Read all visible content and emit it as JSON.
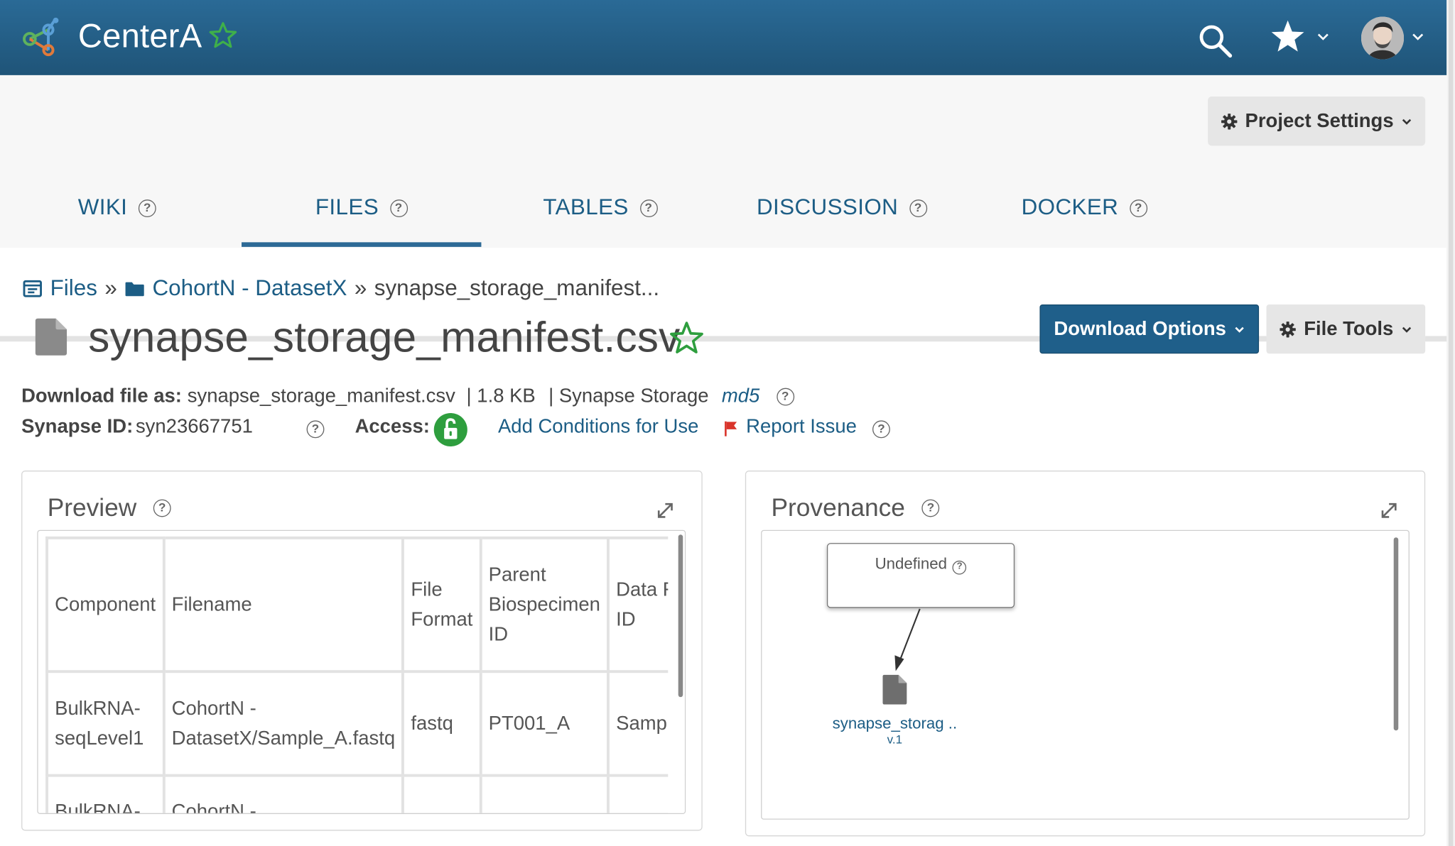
{
  "app": {
    "name": "CenterA"
  },
  "header": {
    "project_settings_label": "Project Settings"
  },
  "tabs": [
    {
      "label": "WIKI",
      "active": false
    },
    {
      "label": "FILES",
      "active": true
    },
    {
      "label": "TABLES",
      "active": false
    },
    {
      "label": "DISCUSSION",
      "active": false
    },
    {
      "label": "DOCKER",
      "active": false
    }
  ],
  "breadcrumb": {
    "root": "Files",
    "folder": "CohortN - DatasetX",
    "current": "synapse_storage_manifest...",
    "separator": "»"
  },
  "file": {
    "name": "synapse_storage_manifest.csv",
    "download_as_label": "Download file as:",
    "download_as_value": "synapse_storage_manifest.csv",
    "size": "| 1.8 KB",
    "storage": "| Synapse Storage",
    "md5_label": "md5",
    "synapse_id_label": "Synapse ID:",
    "synapse_id": "syn23667751",
    "access_label": "Access:",
    "add_conditions": "Add Conditions for Use",
    "report_issue": "Report Issue"
  },
  "buttons": {
    "download_options": "Download Options",
    "file_tools": "File Tools"
  },
  "preview": {
    "title": "Preview",
    "headers": [
      "Component",
      "Filename",
      "File Format",
      "Parent Biospecimen ID",
      "Data F ID"
    ],
    "header_lines": [
      [
        "Component"
      ],
      [
        "Filename"
      ],
      [
        "File",
        "Format"
      ],
      [
        "Parent",
        "Biospecimen",
        "ID"
      ],
      [
        "Data F",
        "ID"
      ]
    ],
    "rows": [
      {
        "component": [
          "BulkRNA-",
          "seqLevel1"
        ],
        "filename": [
          "CohortN -",
          "DatasetX/Sample_A.fastq"
        ],
        "format": "fastq",
        "parent_id": "PT001_A",
        "data_id": "Sampl"
      },
      {
        "component": [
          "BulkRNA-"
        ],
        "filename": [
          "CohortN -"
        ],
        "format": "",
        "parent_id": "",
        "data_id": ""
      }
    ]
  },
  "provenance": {
    "title": "Provenance",
    "activity_label": "Undefined",
    "file_label": "synapse_storag ..",
    "version": "v.1"
  },
  "colors": {
    "topbar": "#1f5478",
    "link": "#1c5d85",
    "primary_button": "#1f5f8a",
    "favorite_star": "#2e9e3e",
    "access_open": "#2e9e3e",
    "flag": "#d9342b"
  }
}
